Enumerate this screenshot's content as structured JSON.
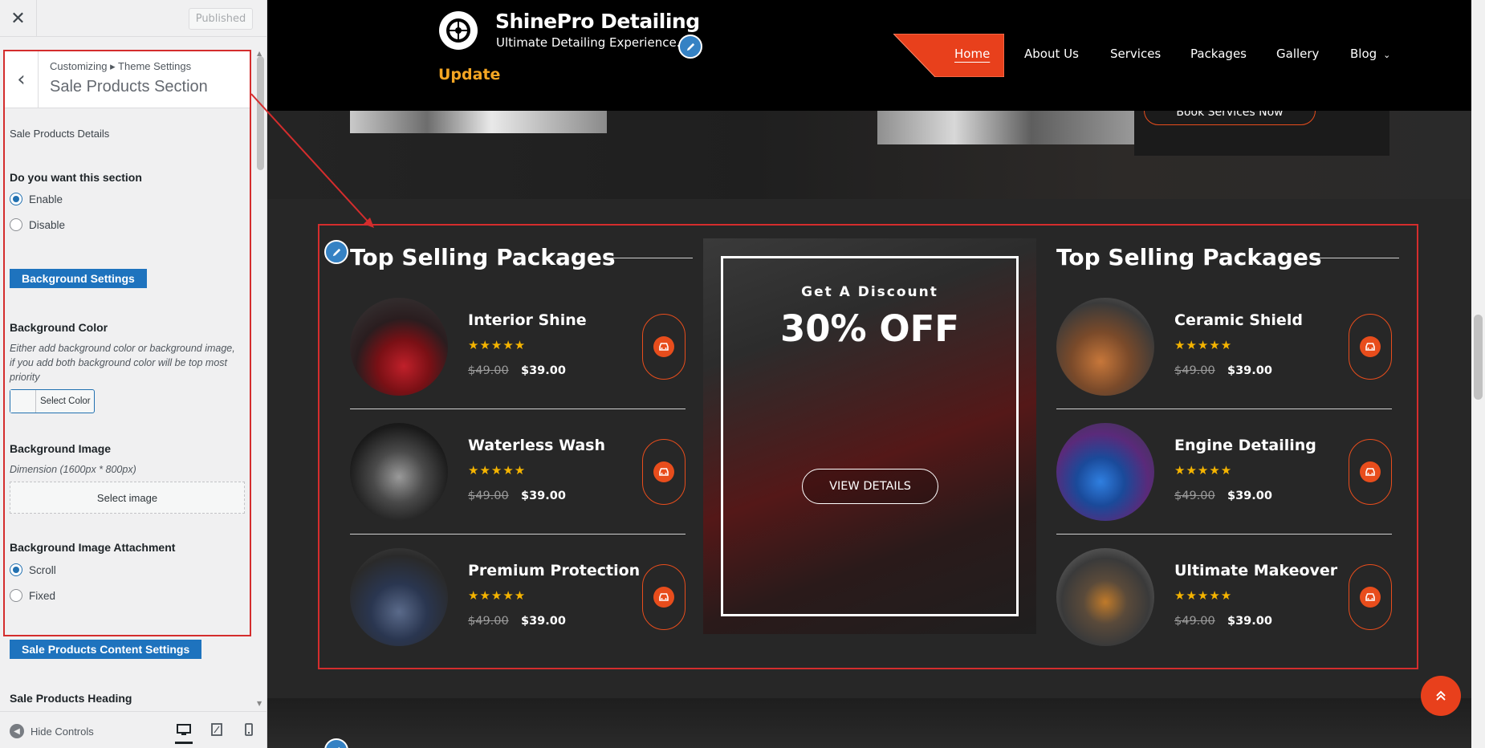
{
  "customizer": {
    "close_icon": "close-icon",
    "publish_label": "Published",
    "breadcrumb": "Customizing ▸ Theme Settings",
    "section_title": "Sale Products Section",
    "details_label": "Sale Products Details",
    "enable_q": "Do you want this section",
    "enable_opts": [
      "Enable",
      "Disable"
    ],
    "bg_settings_btn": "Background Settings",
    "bg_color_label": "Background Color",
    "bg_color_desc": "Either add background color or background image, if you add both background color will be top most priority",
    "select_color": "Select Color",
    "bg_image_label": "Background Image",
    "bg_image_dim": "Dimension (1600px * 800px)",
    "select_image": "Select image",
    "attach_label": "Background Image Attachment",
    "attach_opts": [
      "Scroll",
      "Fixed"
    ],
    "content_settings_btn": "Sale Products Content Settings",
    "heading_label": "Sale Products Heading",
    "hide_controls": "Hide Controls"
  },
  "site": {
    "brand": "ShinePro Detailing",
    "tagline": "Ultimate Detailing Experience.",
    "update": "Update",
    "nav": [
      "Home",
      "About Us",
      "Services",
      "Packages",
      "Gallery",
      "Blog"
    ],
    "book_btn": "Book Services Now",
    "accent": "#e84d1c",
    "star_color": "#f5b400"
  },
  "sale": {
    "heading_left": "Top Selling Packages",
    "heading_right": "Top Selling Packages",
    "left_products": [
      {
        "name": "Interior Shine",
        "old": "$49.00",
        "new": "$39.00",
        "stars": "★★★★★"
      },
      {
        "name": "Waterless Wash",
        "old": "$49.00",
        "new": "$39.00",
        "stars": "★★★★★"
      },
      {
        "name": "Premium Protection",
        "old": "$49.00",
        "new": "$39.00",
        "stars": "★★★★★"
      }
    ],
    "right_products": [
      {
        "name": "Ceramic Shield",
        "old": "$49.00",
        "new": "$39.00",
        "stars": "★★★★★"
      },
      {
        "name": "Engine Detailing",
        "old": "$49.00",
        "new": "$39.00",
        "stars": "★★★★★"
      },
      {
        "name": "Ultimate Makeover",
        "old": "$49.00",
        "new": "$39.00",
        "stars": "★★★★★"
      }
    ],
    "promo_sub": "Get A Discount",
    "promo_big": "30% OFF",
    "promo_btn": "VIEW DETAILS"
  }
}
